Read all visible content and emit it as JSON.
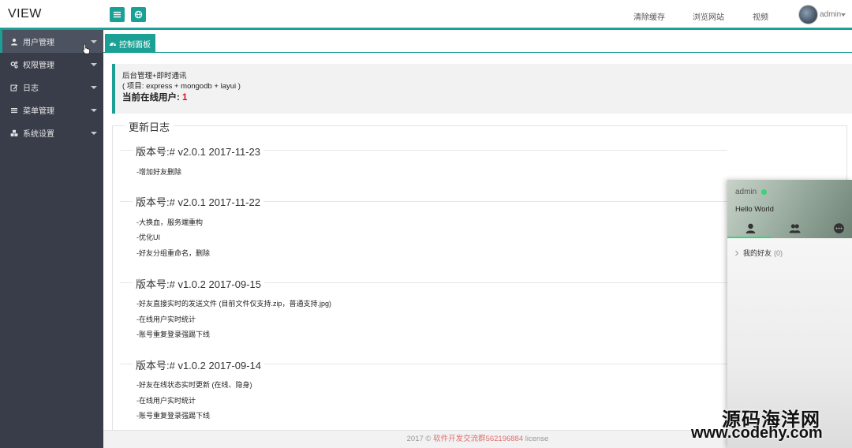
{
  "header": {
    "logo": "VIEW",
    "nav": [
      "清除缓存",
      "浏览网站",
      "视频"
    ],
    "user": "admin"
  },
  "sidebar": {
    "items": [
      {
        "label": "用户管理",
        "icon": "user-icon"
      },
      {
        "label": "权限管理",
        "icon": "gears-icon"
      },
      {
        "label": "日志",
        "icon": "edit-icon"
      },
      {
        "label": "菜单管理",
        "icon": "list-icon"
      },
      {
        "label": "系统设置",
        "icon": "cubes-icon"
      }
    ]
  },
  "tabs": [
    {
      "label": "控制面板",
      "icon": "dashboard-icon"
    }
  ],
  "info": {
    "line1": "后台管理+即时通讯",
    "line2": "( 项目: express + mongodb + layui )",
    "online_label": "当前在线用户:",
    "online_count": "1"
  },
  "changelog": {
    "legend": "更新日志",
    "versions": [
      {
        "title": "版本号:# v2.0.1 2017-11-23",
        "entries": [
          "-增加好友删除"
        ]
      },
      {
        "title": "版本号:# v2.0.1 2017-11-22",
        "entries": [
          "-大换血，服务端重构",
          "-优化UI",
          "-好友分组重命名，删除"
        ]
      },
      {
        "title": "版本号:# v1.0.2 2017-09-15",
        "entries": [
          "-好友直接实时的发送文件 (目前文件仅支持.zip，普通支持.jpg)",
          "-在线用户实时统计",
          "-账号重复登录强踢下线"
        ]
      },
      {
        "title": "版本号:# v1.0.2 2017-09-14",
        "entries": [
          "-好友在线状态实时更新 (在线、隐身)",
          "-在线用户实时统计",
          "-账号重复登录强踢下线"
        ]
      }
    ]
  },
  "footer": {
    "year": "2017 ©",
    "link": "软件开发交流群562196884",
    "license": "license"
  },
  "chat": {
    "name": "admin",
    "sign": "Hello World",
    "group": {
      "label": "我的好友",
      "count": "(0)"
    }
  },
  "watermark": {
    "line1": "源码海洋网",
    "line2": "www.codehy.com"
  },
  "colors": {
    "accent": "#1aa094",
    "sidebar": "#393d49",
    "online": "#3ad37a",
    "count": "#e01010"
  }
}
